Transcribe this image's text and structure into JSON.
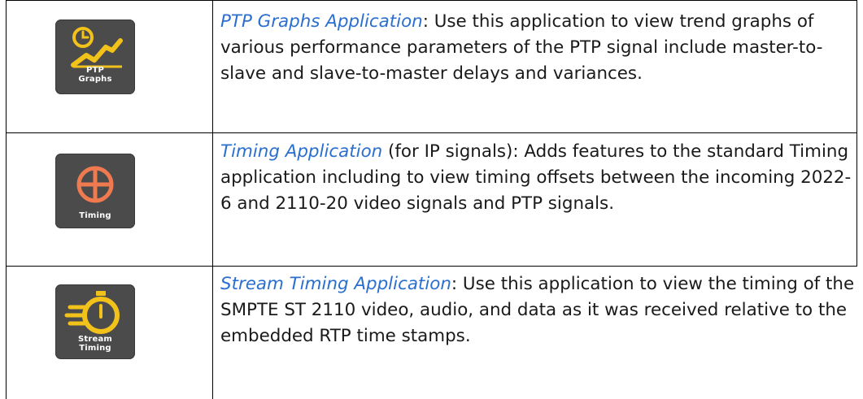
{
  "rows": [
    {
      "icon": {
        "name": "ptp-graphs-icon",
        "label_line1": "PTP",
        "label_line2": "Graphs",
        "color": "#f2c21a"
      },
      "link": "PTP Graphs Application",
      "text": ": Use this application to view trend graphs of various performance parameters of the PTP signal include master-to-slave and slave-to-master delays and variances."
    },
    {
      "icon": {
        "name": "timing-icon",
        "label_line1": "Timing",
        "color": "#f07a50"
      },
      "link": "Timing Application ",
      "text": "(for IP signals): Adds features to the standard Timing application including to view timing offsets between the incoming 2022-6 and 2110-20 video signals and PTP signals."
    },
    {
      "icon": {
        "name": "stream-timing-icon",
        "label_line1": "Stream",
        "label_line2": "Timing",
        "color": "#f2c21a"
      },
      "link": "Stream Timing Application",
      "text": ": Use this application to view the timing of the SMPTE ST 2110 video, audio, and data as it was received relative to the embedded RTP time stamps."
    }
  ]
}
